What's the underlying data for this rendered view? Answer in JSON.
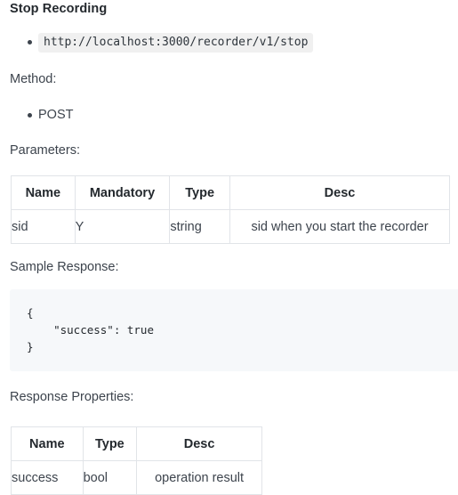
{
  "doc": {
    "title": "Stop Recording",
    "endpoint_url": "http://localhost:3000/recorder/v1/stop",
    "method_label": "Method:",
    "method_value": "POST",
    "parameters_label": "Parameters:",
    "sample_response_label": "Sample Response:",
    "response_properties_label": "Response Properties:",
    "sample_response_code": "{\n    \"success\": true\n}"
  },
  "parameters_table": {
    "headers": [
      "Name",
      "Mandatory",
      "Type",
      "Desc"
    ],
    "rows": [
      {
        "name": "sid",
        "mandatory": "Y",
        "type": "string",
        "desc": "sid when you start the recorder"
      }
    ]
  },
  "response_properties_table": {
    "headers": [
      "Name",
      "Type",
      "Desc"
    ],
    "rows": [
      {
        "name": "success",
        "type": "bool",
        "desc": "operation result"
      }
    ]
  },
  "colors": {
    "text": "#3d444d",
    "heading": "#24292e",
    "table_border": "#e1e4e8",
    "code_block_bg": "#f6f8fa",
    "inline_code_bg": "#f0f0f0"
  }
}
